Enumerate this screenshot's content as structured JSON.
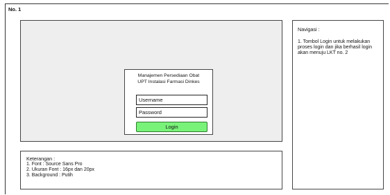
{
  "frame": {
    "title": "No. 1"
  },
  "login": {
    "title_line1": "Manajemen Persediaan Obat",
    "title_line2": "UPT Instalasi Farmasi Dinkes",
    "username_placeholder": "Username",
    "password_placeholder": "Password",
    "login_label": "Login",
    "button_color": "#79f279"
  },
  "navigation": {
    "title": "Navigasi :",
    "items": [
      "1. Tombol Login untuk melakukan proses login dan jika berhasil login akan menuju LKT no. 2"
    ]
  },
  "notes": {
    "title": "Keterangan :",
    "items": [
      "1. Font : Source Sans Pro",
      "2. Ukuran Font : 16px dan 20px",
      "3. Background : Putih"
    ]
  }
}
